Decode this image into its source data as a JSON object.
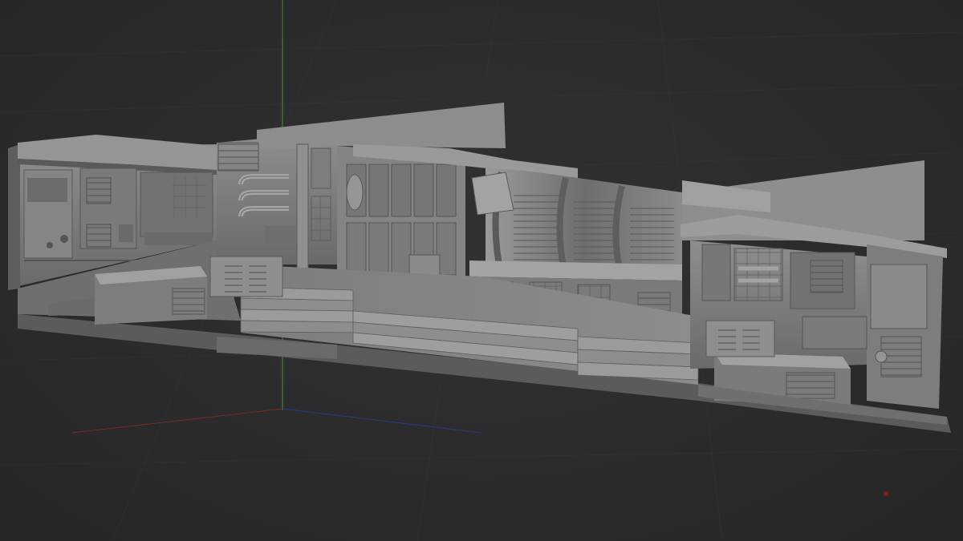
{
  "viewport": {
    "background_color": "#2b2b2c",
    "grid_color": "#3a3a3b",
    "axis_colors": {
      "x": "#8a2a2a",
      "y": "#2f9a3a",
      "z": "#2a3a8a"
    },
    "model_base_color": "#7b7b7c",
    "model_highlight_color": "#a2a2a3",
    "model_shadow_color": "#4a4a4b"
  },
  "marker": {
    "icon": "red-dot-icon",
    "color": "#8a2020"
  }
}
